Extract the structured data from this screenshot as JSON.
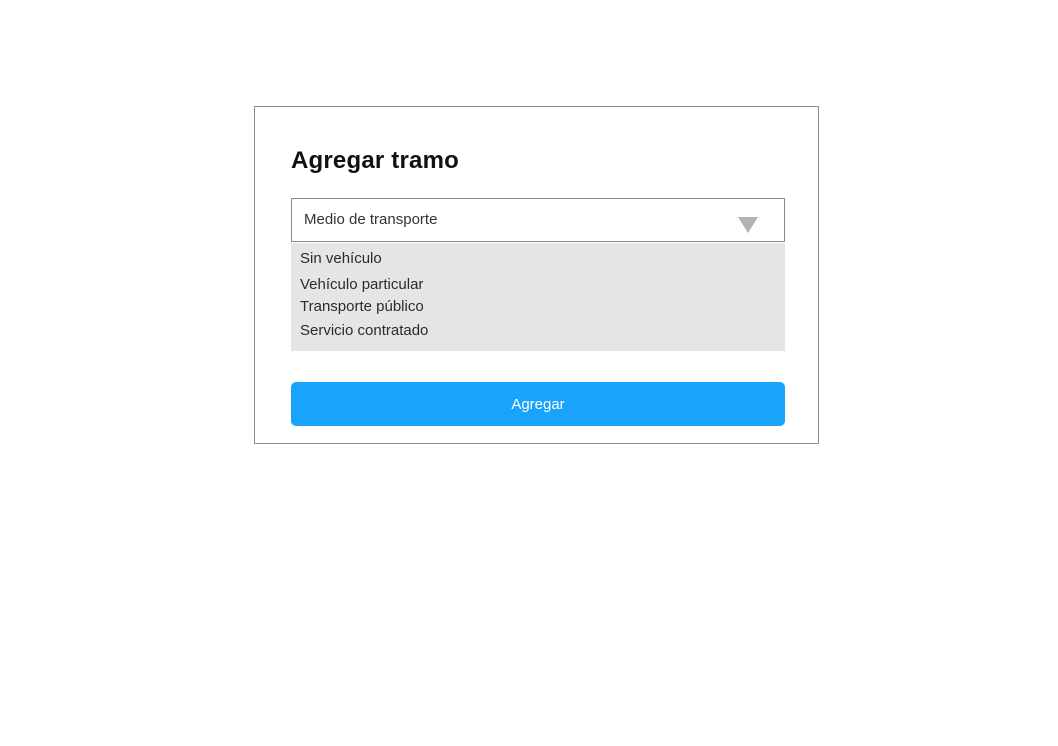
{
  "dialog": {
    "title": "Agregar tramo",
    "select": {
      "label": "Medio de transporte",
      "caret_icon": "triangle-down-icon",
      "options": [
        "Sin vehículo",
        "Vehículo particular",
        "Transporte público",
        "Servicio contratado"
      ]
    },
    "add_label": "Agregar"
  },
  "colors": {
    "primary_button": "#1aa3fb",
    "options_background": "#e5e5e5",
    "border": "#8a8a8a",
    "caret": "#b3b3b3"
  }
}
